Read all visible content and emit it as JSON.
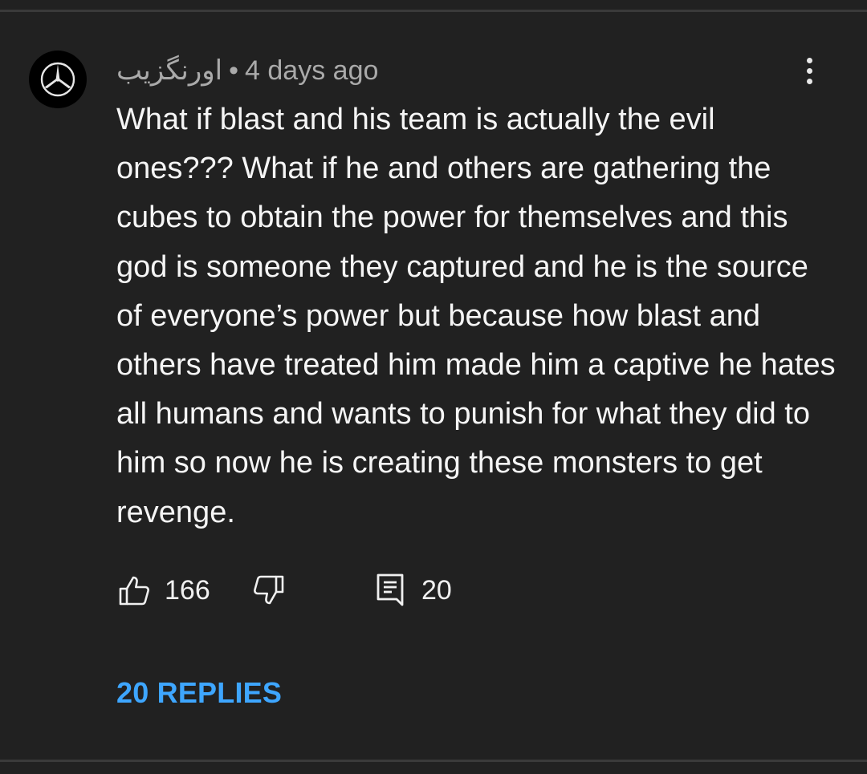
{
  "comment": {
    "author": "اورنگزیب",
    "separator": "•",
    "timestamp": "4 days ago",
    "text": "What if blast and his team is actually the evil ones??? What if he and others are gathering the cubes to obtain the power for themselves and this god is someone they captured and he is the source of everyone’s power but because how blast and others have treated him made him a captive he hates all humans and wants to punish for what they did to him so now he is creating these monsters to get revenge.",
    "likes": "166",
    "reply_count": "20",
    "replies_label": "20 REPLIES"
  },
  "icons": {
    "avatar": "mercedes-star-logo",
    "more": "vertical-ellipsis-icon",
    "like": "thumbs-up-icon",
    "dislike": "thumbs-down-icon",
    "reply": "comment-icon"
  },
  "colors": {
    "background": "#212121",
    "text": "#f5f5f5",
    "meta": "#aaaaaa",
    "link": "#3ea6ff"
  }
}
